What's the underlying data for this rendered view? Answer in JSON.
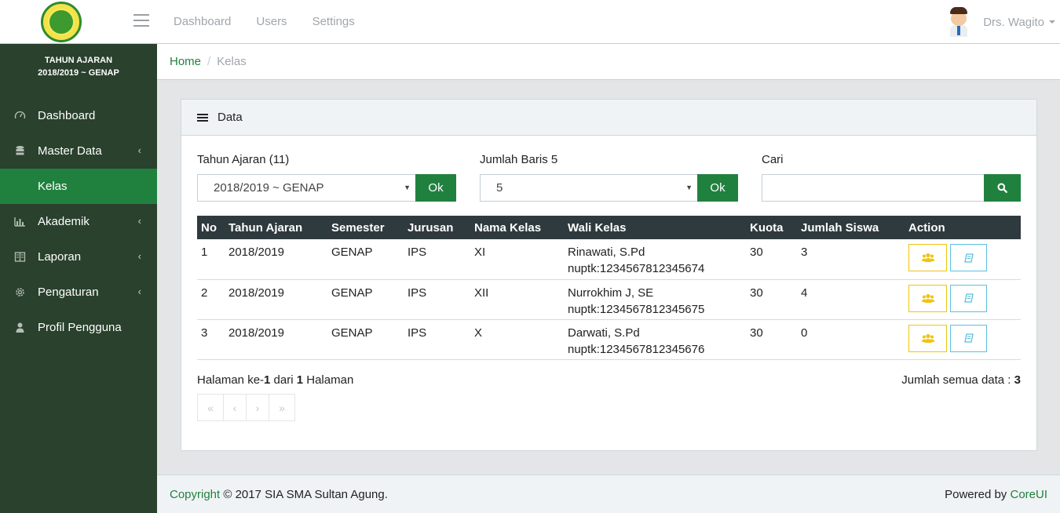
{
  "header": {
    "nav": [
      "Dashboard",
      "Users",
      "Settings"
    ],
    "user_name": "Drs. Wagito"
  },
  "sidebar": {
    "year_line1": "TAHUN AJARAN",
    "year_line2": "2018/2019 ~ GENAP",
    "items": [
      {
        "label": "Dashboard",
        "icon": "speedometer-icon"
      },
      {
        "label": "Master Data",
        "icon": "database-icon"
      },
      {
        "label": "Kelas",
        "icon": ""
      },
      {
        "label": "Akademik",
        "icon": "bar-chart-icon"
      },
      {
        "label": "Laporan",
        "icon": "book-icon"
      },
      {
        "label": "Pengaturan",
        "icon": "gear-icon"
      },
      {
        "label": "Profil Pengguna",
        "icon": "user-icon"
      }
    ]
  },
  "breadcrumb": {
    "home": "Home",
    "current": "Kelas"
  },
  "card": {
    "title": "Data",
    "filters": {
      "tahun_label": "Tahun Ajaran (11)",
      "tahun_value": "2018/2019 ~ GENAP",
      "baris_label": "Jumlah Baris 5",
      "baris_value": "5",
      "cari_label": "Cari",
      "ok_label": "Ok"
    },
    "table": {
      "headers": [
        "No",
        "Tahun Ajaran",
        "Semester",
        "Jurusan",
        "Nama Kelas",
        "Wali Kelas",
        "Kuota",
        "Jumlah Siswa",
        "Action"
      ],
      "rows": [
        {
          "no": "1",
          "tahun": "2018/2019",
          "semester": "GENAP",
          "jurusan": "IPS",
          "kelas": "XI",
          "wali": "Rinawati, S.Pd",
          "nuptk": "nuptk:1234567812345674",
          "kuota": "30",
          "jumlah": "3"
        },
        {
          "no": "2",
          "tahun": "2018/2019",
          "semester": "GENAP",
          "jurusan": "IPS",
          "kelas": "XII",
          "wali": "Nurrokhim J, SE",
          "nuptk": "nuptk:1234567812345675",
          "kuota": "30",
          "jumlah": "4"
        },
        {
          "no": "3",
          "tahun": "2018/2019",
          "semester": "GENAP",
          "jurusan": "IPS",
          "kelas": "X",
          "wali": "Darwati, S.Pd",
          "nuptk": "nuptk:1234567812345676",
          "kuota": "30",
          "jumlah": "0"
        }
      ]
    },
    "pagination": {
      "prefix": "Halaman ke-",
      "current": "1",
      "middle": " dari ",
      "total": "1",
      "suffix": " Halaman",
      "total_label": "Jumlah semua data : ",
      "total_count": "3",
      "buttons": [
        "«",
        "‹",
        "›",
        "»"
      ]
    }
  },
  "footer": {
    "copyright_link": "Copyright",
    "copyright_text": " © 2017 SIA SMA Sultan Agung.",
    "powered_text": "Powered by ",
    "powered_link": "CoreUI"
  },
  "colors": {
    "primary": "#20813e",
    "sidebar": "#29412d",
    "table_header": "#2f3a3e",
    "warning": "#f1c40f",
    "info": "#5bc0de"
  }
}
